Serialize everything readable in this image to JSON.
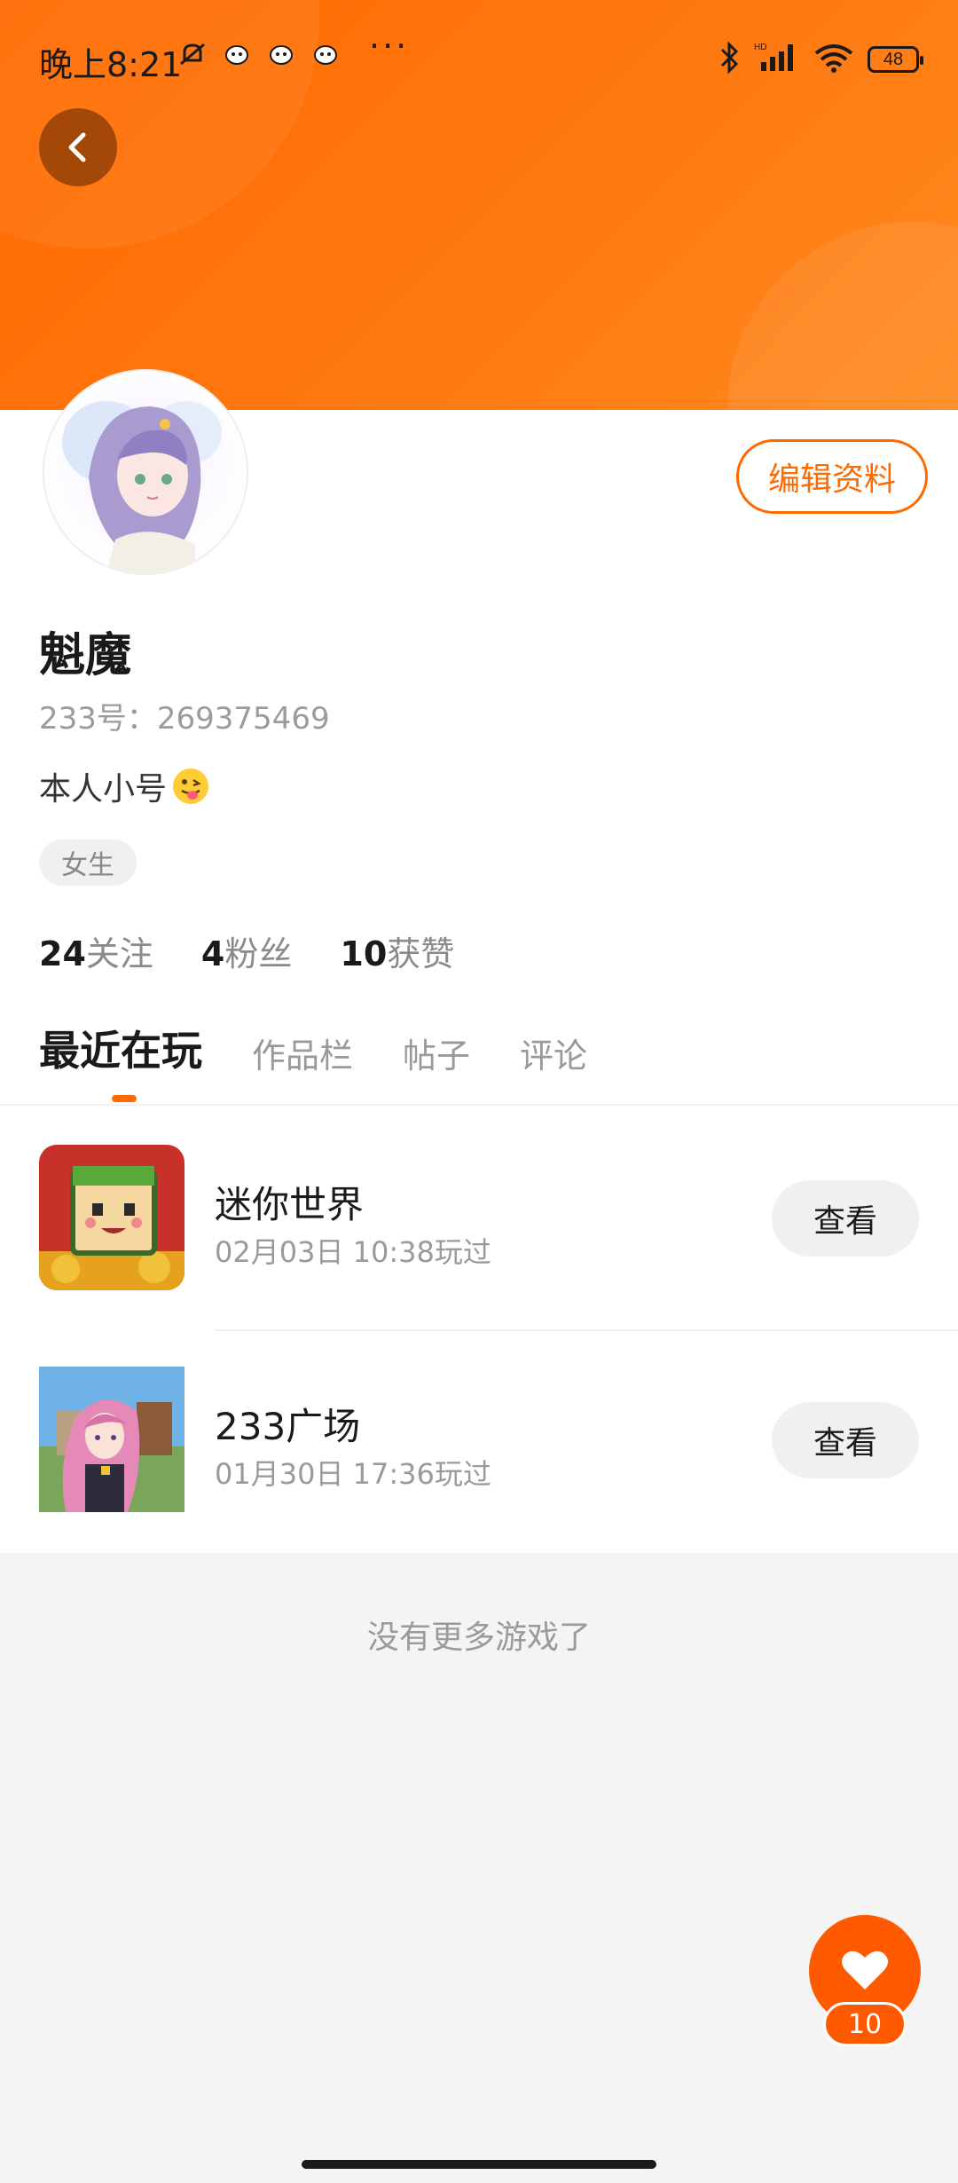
{
  "status_bar": {
    "time": "晚上8:21",
    "more": "···",
    "battery": "48"
  },
  "profile": {
    "edit_label": "编辑资料",
    "nickname": "魁魔",
    "uid": "233号：269375469",
    "bio": "本人小号",
    "gender": "女生",
    "stats": [
      {
        "num": "24",
        "label": "关注"
      },
      {
        "num": "4",
        "label": "粉丝"
      },
      {
        "num": "10",
        "label": "获赞"
      }
    ]
  },
  "tabs": [
    {
      "label": "最近在玩",
      "active": true
    },
    {
      "label": "作品栏",
      "active": false
    },
    {
      "label": "帖子",
      "active": false
    },
    {
      "label": "评论",
      "active": false
    }
  ],
  "games": [
    {
      "name": "迷你世界",
      "time": "02月03日 10:38玩过",
      "button": "查看"
    },
    {
      "name": "233广场",
      "time": "01月30日 17:36玩过",
      "button": "查看"
    }
  ],
  "footer_text": "没有更多游戏了",
  "like": {
    "count": "10"
  },
  "colors": {
    "accent": "#ff6a00",
    "banner": "#ff7a12"
  }
}
